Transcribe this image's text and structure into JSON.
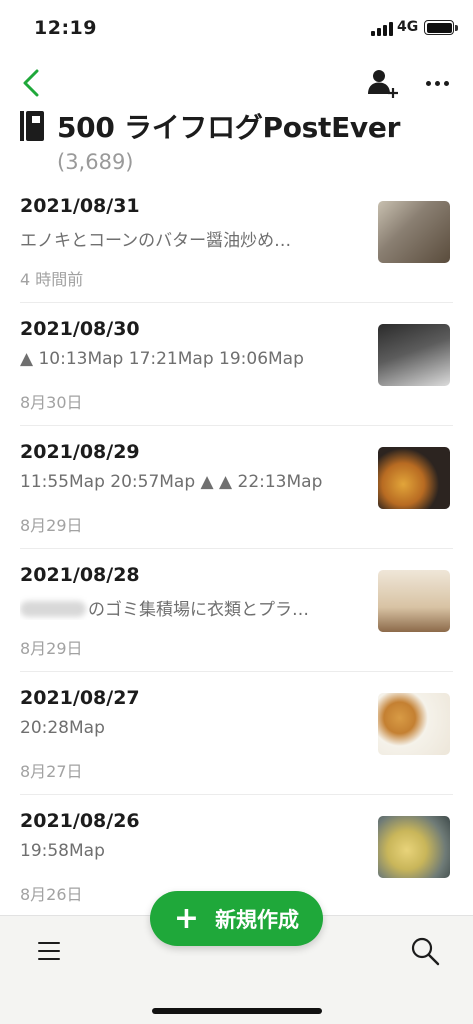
{
  "status_bar": {
    "time": "12:19",
    "network": "4G"
  },
  "notebook": {
    "title": "500 ライフログPostEver",
    "count": "(3,689)"
  },
  "notes": [
    {
      "title": "2021/08/31",
      "snippet": "エノキとコーンのバター醤油炒め…",
      "date": "4 時間前"
    },
    {
      "title": "2021/08/30",
      "snippet": "▲ 10:13Map 17:21Map 19:06Map",
      "date": "8月30日"
    },
    {
      "title": "2021/08/29",
      "snippet": "11:55Map 20:57Map ▲ ▲ 22:13Map",
      "date": "8月29日"
    },
    {
      "title": "2021/08/28",
      "snippet": "のゴミ集積場に衣類とプラ…",
      "date": "8月29日"
    },
    {
      "title": "2021/08/27",
      "snippet": "20:28Map",
      "date": "8月27日"
    },
    {
      "title": "2021/08/26",
      "snippet": "19:58Map",
      "date": "8月26日"
    }
  ],
  "fab": {
    "label": "新規作成"
  },
  "colors": {
    "accent": "#1fa83a",
    "back_arrow": "#1fa83a"
  },
  "icons": {
    "back": "chevron-left-icon",
    "share": "add-user-icon",
    "more": "more-horizontal-icon",
    "menu": "hamburger-menu-icon",
    "search": "search-icon",
    "notebook": "notebook-icon"
  }
}
